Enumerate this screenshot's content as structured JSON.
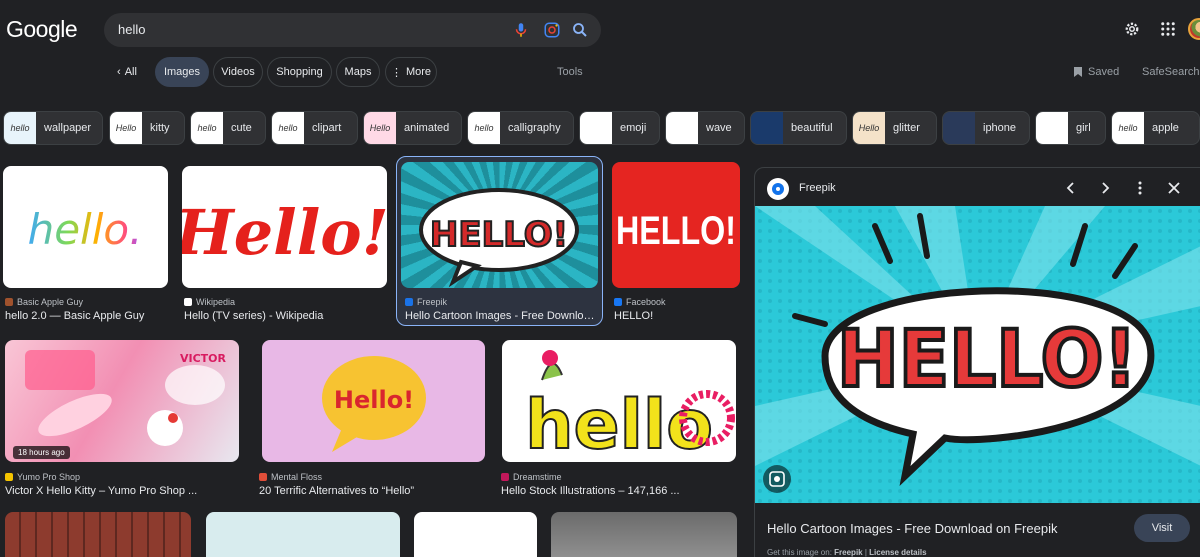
{
  "header": {
    "logo": "Google",
    "query": "hello"
  },
  "tabs": {
    "back_label": "All",
    "items": [
      "Images",
      "Videos",
      "Shopping",
      "Maps"
    ],
    "more_label": "More",
    "tools_label": "Tools",
    "saved_label": "Saved",
    "safesearch_label": "SafeSearch"
  },
  "chips": [
    {
      "label": "wallpaper",
      "thumb": "hello"
    },
    {
      "label": "kitty",
      "thumb": "Hello"
    },
    {
      "label": "cute",
      "thumb": "hello"
    },
    {
      "label": "clipart",
      "thumb": "hello"
    },
    {
      "label": "animated",
      "thumb": "Hello"
    },
    {
      "label": "calligraphy",
      "thumb": "hello"
    },
    {
      "label": "emoji",
      "thumb": ""
    },
    {
      "label": "wave",
      "thumb": ""
    },
    {
      "label": "beautiful",
      "thumb": ""
    },
    {
      "label": "glitter",
      "thumb": "Hello"
    },
    {
      "label": "iphone",
      "thumb": ""
    },
    {
      "label": "girl",
      "thumb": ""
    },
    {
      "label": "apple",
      "thumb": "hello"
    }
  ],
  "results": [
    {
      "source": "Basic Apple Guy",
      "title": "hello 2.0 — Basic Apple Guy",
      "img_text": "hello."
    },
    {
      "source": "Wikipedia",
      "title": "Hello (TV series) - Wikipedia",
      "img_text": "Hello!"
    },
    {
      "source": "Freepik",
      "title": "Hello Cartoon Images - Free Download ...",
      "img_text": "HELLO!"
    },
    {
      "source": "Facebook",
      "title": "HELLO!",
      "img_text": "HELLO!"
    },
    {
      "source": "Yumo Pro Shop",
      "title": "Victor X Hello Kitty – Yumo Pro Shop ...",
      "img_text": "VICTOR",
      "badge": "18 hours ago"
    },
    {
      "source": "Mental Floss",
      "title": "20 Terrific Alternatives to “Hello”",
      "img_text": "Hello!"
    },
    {
      "source": "Dreamstime",
      "title": "Hello Stock Illustrations – 147,166 ...",
      "img_text": "hello"
    }
  ],
  "panel": {
    "source": "Freepik",
    "img_text": "HELLO!",
    "title": "Hello Cartoon Images - Free Download on Freepik",
    "visit_label": "Visit",
    "get_prefix": "Get this image on:",
    "get_source": "Freepik",
    "license": "License details"
  },
  "colors": {
    "background": "#202124",
    "accent_blue": "#8ab4f8",
    "freepik_red": "#e63a3a",
    "comic_teal": "#2bc9d8"
  }
}
